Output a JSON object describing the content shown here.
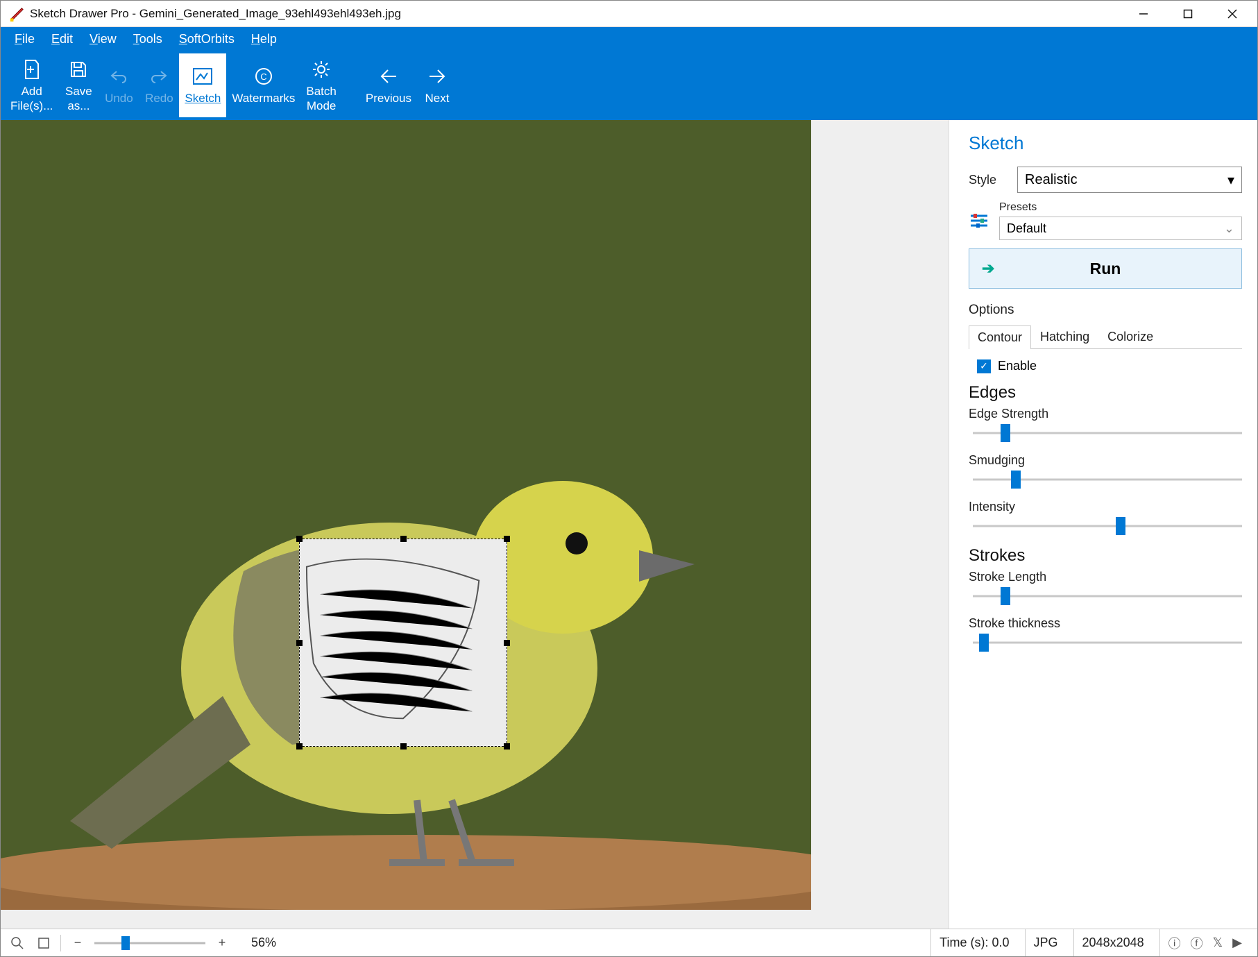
{
  "titlebar": {
    "app_name": "Sketch Drawer Pro",
    "separator": " - ",
    "file_name": "Gemini_Generated_Image_93ehl493ehl493eh.jpg"
  },
  "menu": {
    "items": [
      {
        "key": "F",
        "rest": "ile"
      },
      {
        "key": "E",
        "rest": "dit"
      },
      {
        "key": "V",
        "rest": "iew"
      },
      {
        "key": "T",
        "rest": "ools"
      },
      {
        "key": "S",
        "rest": "oftOrbits"
      },
      {
        "key": "H",
        "rest": "elp"
      }
    ]
  },
  "toolbar": {
    "add_files": "Add\nFile(s)...",
    "save_as": "Save\nas...",
    "undo": "Undo",
    "redo": "Redo",
    "sketch": "Sketch",
    "watermarks": "Watermarks",
    "batch_mode": "Batch\nMode",
    "previous": "Previous",
    "next": "Next"
  },
  "panel": {
    "title": "Sketch",
    "style_label": "Style",
    "style_value": "Realistic",
    "presets_label": "Presets",
    "presets_value": "Default",
    "run": "Run",
    "options": "Options",
    "tabs": {
      "contour": "Contour",
      "hatching": "Hatching",
      "colorize": "Colorize"
    },
    "enable": "Enable",
    "enable_checked": true,
    "edges": {
      "title": "Edges",
      "strength_label": "Edge Strength",
      "strength_pct": 12,
      "smudging_label": "Smudging",
      "smudging_pct": 16,
      "intensity_label": "Intensity",
      "intensity_pct": 55
    },
    "strokes": {
      "title": "Strokes",
      "length_label": "Stroke Length",
      "length_pct": 12,
      "thickness_label": "Stroke thickness",
      "thickness_pct": 4
    }
  },
  "status": {
    "zoom_pct": 28,
    "zoom_text": "56%",
    "time_label": "Time (s): 0.0",
    "format": "JPG",
    "dimensions": "2048x2048"
  }
}
